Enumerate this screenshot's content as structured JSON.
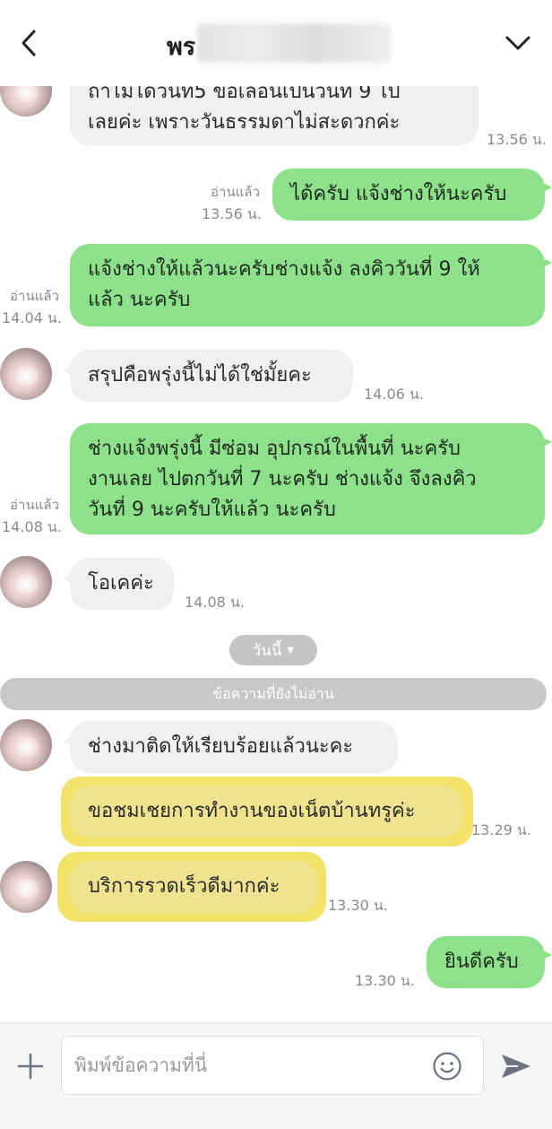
{
  "header": {
    "title": "พร",
    "back_icon": "chevron-left-icon",
    "menu_icon": "chevron-down-icon"
  },
  "messages": [
    {
      "side": "in",
      "text": "ถ้าไม่ได้วันที่5 ขอเลื่อนเป็นวันที่ 9 ไป\nเลยค่ะ เพราะวันธรรมดาไม่สะดวกค่ะ",
      "time": "13.56 น."
    },
    {
      "side": "out",
      "text": "ได้ครับ แจ้งช่างให้นะครับ",
      "read": "อ่านแล้ว",
      "time": "13.56 น."
    },
    {
      "side": "out",
      "text": "แจ้งช่างให้แล้วนะครับช่างแจ้ง ลงคิววันที่ 9 ให้\nแล้ว นะครับ",
      "read": "อ่านแล้ว",
      "time": "14.04 น."
    },
    {
      "side": "in",
      "text": "สรุปคือพรุ่งนี้ไม่ได้ใช่มั้ยคะ",
      "time": "14.06 น."
    },
    {
      "side": "out",
      "text": "ช่างแจ้งพรุ่งนี้ มีซ่อม อุปกรณ์ในพื้นที่ นะครับ\nงานเลย ไปตกวันที่ 7 นะครับ ช่างแจ้ง จึงลงคิว\nวันที่ 9 นะครับให้แล้ว นะครับ",
      "read": "อ่านแล้ว",
      "time": "14.08 น."
    },
    {
      "side": "in",
      "text": "โอเคค่ะ",
      "time": "14.08 น."
    }
  ],
  "date_divider": "วันนี้",
  "unread_divider": "ข้อความที่ยังไม่อ่าน",
  "today_messages": [
    {
      "side": "in",
      "text": "ช่างมาติดให้เรียบร้อยแล้วนะคะ",
      "time": ""
    },
    {
      "side": "in",
      "text": "ขอชมเชยการทำงานของเน็ตบ้านทรูค่ะ",
      "time": "13.29 น.",
      "highlight": true
    },
    {
      "side": "in",
      "text": "บริการรวดเร็วดีมากค่ะ",
      "time": "13.30 น.",
      "highlight": true
    },
    {
      "side": "out",
      "text": "ยินดีครับ",
      "time": "13.30 น."
    }
  ],
  "input": {
    "placeholder": "พิมพ์ข้อความที่นี่",
    "value": ""
  },
  "colors": {
    "outgoing": "#8de18a",
    "incoming": "#f0f0f1",
    "highlight": "#f3e36a"
  }
}
